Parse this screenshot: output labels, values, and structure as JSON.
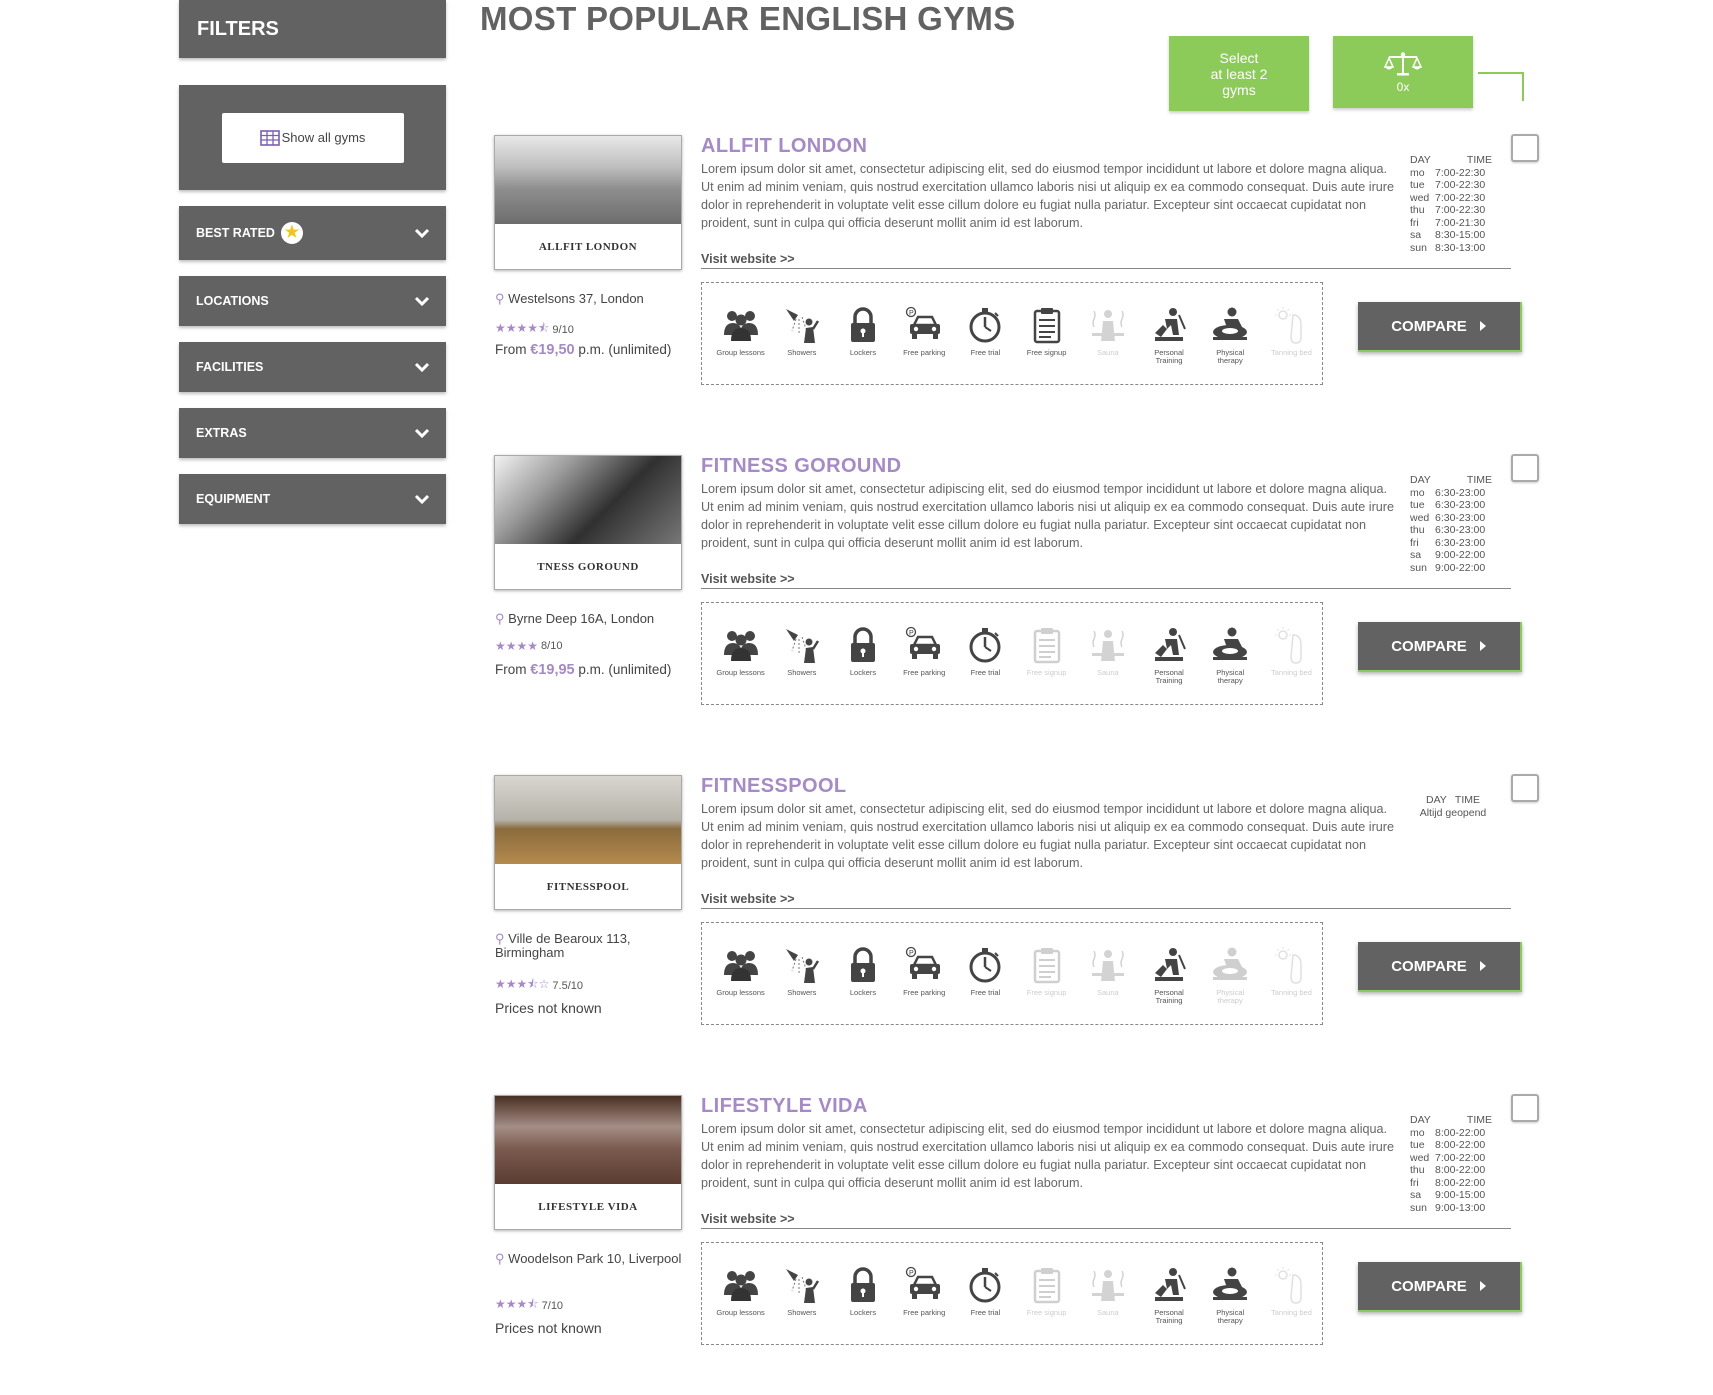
{
  "sidebar": {
    "title": "FILTERS",
    "show_all": "Show all gyms",
    "categories": [
      "BEST RATED",
      "LOCATIONS",
      "FACILITIES",
      "EXTRAS",
      "EQUIPMENT"
    ]
  },
  "main": {
    "title": "MOST POPULAR ENGLISH GYMS",
    "select_line1": "Select",
    "select_line2": "at least 2",
    "select_line3": "gyms",
    "compare_count": "0x"
  },
  "labels": {
    "visit": "Visit website >>",
    "compare": "COMPARE",
    "day": "DAY",
    "time": "TIME"
  },
  "facility_labels": [
    "Group lessons",
    "Showers",
    "Lockers",
    "Free parking",
    "Free trial",
    "Free signup",
    "Sauna",
    "Personal Training",
    "Physical therapy",
    "Tanning bed"
  ],
  "gyms": [
    {
      "name": "ALLFIT LONDON",
      "logo_text": "ALLFIT LONDON",
      "description": "Lorem ipsum dolor sit amet, consectetur adipiscing elit, sed do eiusmod tempor incididunt ut labore et dolore magna aliqua. Ut enim ad minim veniam, quis nostrud exercitation ullamco laboris nisi ut aliquip ex ea commodo consequat. Duis aute irure dolor in reprehenderit in voluptate velit esse cillum dolore eu fugiat nulla pariatur. Excepteur sint occaecat cupidatat non proident, sunt in culpa qui officia deserunt mollit anim id est laborum.",
      "address": "Westelsons 37, London",
      "stars": "★★★★⯪",
      "rating": "9/10",
      "price_prefix": "From ",
      "price": "€19,50",
      "price_suffix": " p.m. (unlimited)",
      "hours": [
        [
          "mo",
          "7:00-22:30"
        ],
        [
          "tue",
          "7:00-22:30"
        ],
        [
          "wed",
          "7:00-22:30"
        ],
        [
          "thu",
          "7:00-22:30"
        ],
        [
          "fri",
          "7:00-21:30"
        ],
        [
          "sa",
          "8:30-15:00"
        ],
        [
          "sun",
          "8:30-13:00"
        ]
      ],
      "facilities": [
        true,
        true,
        true,
        true,
        true,
        true,
        false,
        true,
        true,
        false
      ]
    },
    {
      "name": "FITNESS GOROUND",
      "logo_text": "TNESS GOROUND",
      "description": "Lorem ipsum dolor sit amet, consectetur adipiscing elit, sed do eiusmod tempor incididunt ut labore et dolore magna aliqua. Ut enim ad minim veniam, quis nostrud exercitation ullamco laboris nisi ut aliquip ex ea commodo consequat. Duis aute irure dolor in reprehenderit in voluptate velit esse cillum dolore eu fugiat nulla pariatur. Excepteur sint occaecat cupidatat non proident, sunt in culpa qui officia deserunt mollit anim id est laborum.",
      "address": "Byrne Deep 16A, London",
      "stars": "★★★★",
      "rating": "8/10",
      "price_prefix": "From ",
      "price": "€19,95",
      "price_suffix": " p.m. (unlimited)",
      "hours": [
        [
          "mo",
          "6:30-23:00"
        ],
        [
          "tue",
          "6:30-23:00"
        ],
        [
          "wed",
          "6:30-23:00"
        ],
        [
          "thu",
          "6:30-23:00"
        ],
        [
          "fri",
          "6:30-23:00"
        ],
        [
          "sa",
          "9:00-22:00"
        ],
        [
          "sun",
          "9:00-22:00"
        ]
      ],
      "facilities": [
        true,
        true,
        true,
        true,
        true,
        false,
        false,
        true,
        true,
        false
      ]
    },
    {
      "name": "FITNESSPOOL",
      "logo_text": "FITNESSPOOL",
      "description": "Lorem ipsum dolor sit amet, consectetur adipiscing elit, sed do eiusmod tempor incididunt ut labore et dolore magna aliqua. Ut enim ad minim veniam, quis nostrud exercitation ullamco laboris nisi ut aliquip ex ea commodo consequat. Duis aute irure dolor in reprehenderit in voluptate velit esse cillum dolore eu fugiat nulla pariatur. Excepteur sint occaecat cupidatat non proident, sunt in culpa qui officia deserunt mollit anim id est laborum.",
      "address": "Ville de Bearoux 113, Birmingham",
      "stars": "★★★⯪☆",
      "rating": "7.5/10",
      "price_text": "Prices not known",
      "hours_text": "Altijd geopend",
      "facilities": [
        true,
        true,
        true,
        true,
        true,
        false,
        false,
        true,
        false,
        false
      ]
    },
    {
      "name": "LIFESTYLE VIDA",
      "logo_text": "LIFESTYLE VIDA",
      "description": "Lorem ipsum dolor sit amet, consectetur adipiscing elit, sed do eiusmod tempor incididunt ut labore et dolore magna aliqua. Ut enim ad minim veniam, quis nostrud exercitation ullamco laboris nisi ut aliquip ex ea commodo consequat. Duis aute irure dolor in reprehenderit in voluptate velit esse cillum dolore eu fugiat nulla pariatur. Excepteur sint occaecat cupidatat non proident, sunt in culpa qui officia deserunt mollit anim id est laborum.",
      "address": "Woodelson Park 10, Liverpool",
      "stars": "★★★⯪",
      "rating": "7/10",
      "price_text": "Prices not known",
      "hours": [
        [
          "mo",
          "8:00-22:00"
        ],
        [
          "tue",
          "8:00-22:00"
        ],
        [
          "wed",
          "7:00-22:00"
        ],
        [
          "thu",
          "8:00-22:00"
        ],
        [
          "fri",
          "8:00-22:00"
        ],
        [
          "sa",
          "9:00-15:00"
        ],
        [
          "sun",
          "9:00-13:00"
        ]
      ],
      "facilities": [
        true,
        true,
        true,
        true,
        true,
        false,
        false,
        true,
        true,
        false
      ]
    }
  ],
  "colors": {
    "accent": "#a58ac6",
    "green": "#8ccb5a",
    "panel": "#626262"
  }
}
